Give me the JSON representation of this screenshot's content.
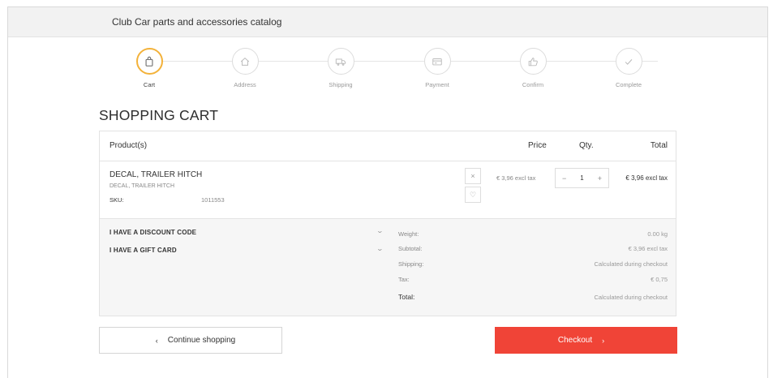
{
  "header": {
    "title": "Club Car parts and accessories catalog"
  },
  "steps": [
    {
      "label": "Cart",
      "icon": "shopping-bag-icon",
      "active": true
    },
    {
      "label": "Address",
      "icon": "home-icon",
      "active": false
    },
    {
      "label": "Shipping",
      "icon": "truck-icon",
      "active": false
    },
    {
      "label": "Payment",
      "icon": "credit-card-icon",
      "active": false
    },
    {
      "label": "Confirm",
      "icon": "thumbs-up-icon",
      "active": false
    },
    {
      "label": "Complete",
      "icon": "checkmark-icon",
      "active": false
    }
  ],
  "page_title": "SHOPPING CART",
  "cart": {
    "headers": {
      "product": "Product(s)",
      "price": "Price",
      "qty": "Qty.",
      "total": "Total"
    },
    "item": {
      "name": "DECAL, TRAILER HITCH",
      "description": "DECAL, TRAILER HITCH",
      "sku_label": "SKU:",
      "sku": "1011553",
      "remove_symbol": "×",
      "wishlist_symbol": "♡",
      "price": "€ 3,96 excl tax",
      "quantity": "1",
      "minus": "−",
      "plus": "+",
      "line_total": "€ 3,96 excl tax"
    },
    "options": {
      "discount": "I HAVE A DISCOUNT CODE",
      "giftcard": "I HAVE A GIFT CARD",
      "chevron": "⌄"
    },
    "summary": {
      "weight_label": "Weight:",
      "weight": "0.00 kg",
      "subtotal_label": "Subtotal:",
      "subtotal": "€ 3,96 excl tax",
      "shipping_label": "Shipping:",
      "shipping": "Calculated during checkout",
      "tax_label": "Tax:",
      "tax": "€ 0,75",
      "total_label": "Total:",
      "total": "Calculated during checkout"
    }
  },
  "buttons": {
    "continue": "Continue shopping",
    "continue_arrow": "‹",
    "checkout": "Checkout",
    "checkout_arrow": "›"
  },
  "colors": {
    "accent": "#f3b23a",
    "checkout": "#f04437",
    "summary_bg": "#f6f6f6"
  }
}
